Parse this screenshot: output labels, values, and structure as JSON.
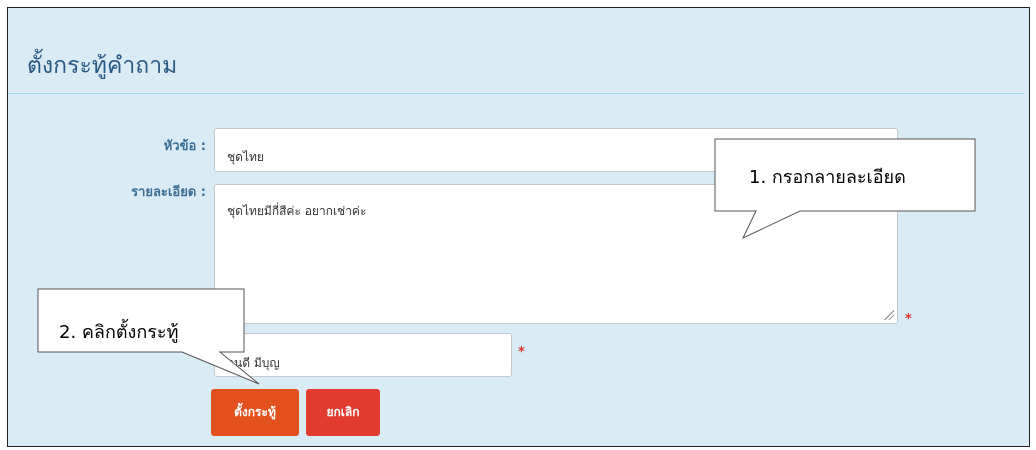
{
  "page": {
    "title": "ตั้งกระทู้คำถาม"
  },
  "form": {
    "topic_label": "หัวข้อ :",
    "topic_value": "ชุดไทย",
    "detail_label": "รายละเอียด :",
    "detail_value": "ชุดไทยมีกี่สีค่ะ อยากเช่าค่ะ",
    "name_value": "จนดี มีบุญ",
    "required_mark": "*"
  },
  "buttons": {
    "submit_label": "ตั้งกระทู้",
    "cancel_label": "ยกเลิก"
  },
  "callouts": {
    "step1": "1. กรอกลายละเอียด",
    "step2": "2. คลิกตั้งกระทู้"
  },
  "colors": {
    "panel_bg": "#d9ecf6",
    "title_text": "#2a5a84",
    "label_text": "#3a6e96",
    "submit_button": "#e2511d",
    "cancel_button": "#e23b30",
    "required": "#d9342b"
  }
}
